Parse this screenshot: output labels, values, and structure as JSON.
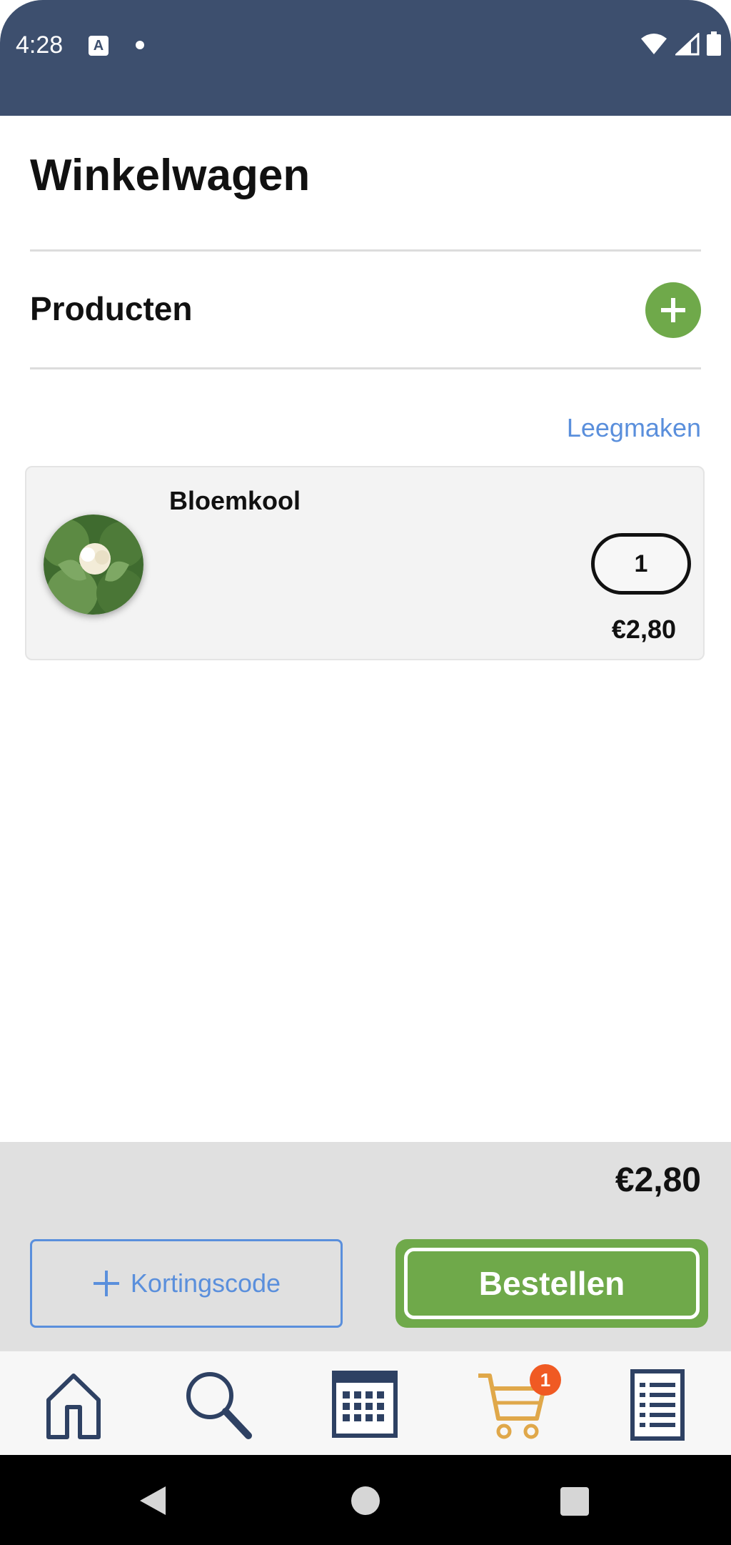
{
  "status_bar": {
    "time": "4:28",
    "notification_letter": "A"
  },
  "page": {
    "title": "Winkelwagen"
  },
  "products_section": {
    "title": "Producten",
    "clear_label": "Leegmaken"
  },
  "cart_items": [
    {
      "name": "Bloemkool",
      "quantity": "1",
      "price": "€2,80"
    }
  ],
  "footer": {
    "total": "€2,80",
    "discount_label": "Kortingscode",
    "order_label": "Bestellen"
  },
  "nav": {
    "cart_badge": "1",
    "items": [
      "home-icon",
      "search-icon",
      "calendar-icon",
      "cart-icon",
      "list-icon"
    ],
    "active_item": "cart-icon",
    "active_color": "#e0a84a",
    "inactive_color": "#2e4163"
  },
  "colors": {
    "header": "#3d4f6e",
    "accent_green": "#6fa94a",
    "link_blue": "#5a8fdc",
    "badge": "#f05a23"
  }
}
